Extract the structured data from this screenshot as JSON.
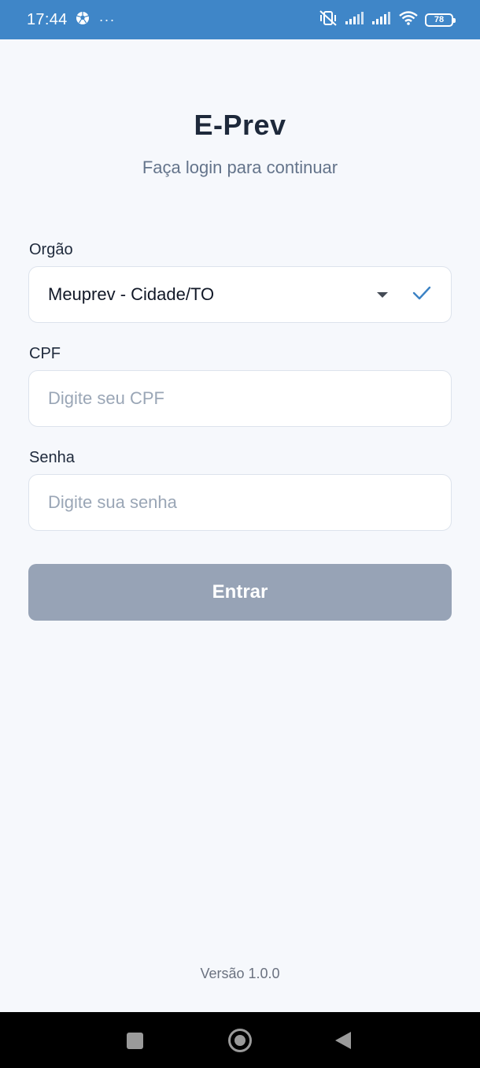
{
  "status_bar": {
    "time": "17:44",
    "more": "···",
    "battery": "78",
    "icons": [
      "soccer-ball-icon",
      "vibrate-off-icon",
      "signal-icon",
      "signal-icon",
      "wifi-icon",
      "battery-icon"
    ]
  },
  "header": {
    "title": "E-Prev",
    "subtitle": "Faça login para continuar"
  },
  "form": {
    "orgao_label": "Orgão",
    "orgao_value": "Meuprev - Cidade/TO",
    "cpf_label": "CPF",
    "cpf_placeholder": "Digite seu CPF",
    "cpf_value": "",
    "senha_label": "Senha",
    "senha_placeholder": "Digite sua senha",
    "senha_value": "",
    "submit_label": "Entrar"
  },
  "footer": {
    "version": "Versão 1.0.0"
  },
  "colors": {
    "status_bar": "#3f86c8",
    "background": "#f6f8fc",
    "button_disabled": "#97a3b6",
    "check": "#3b82c4"
  }
}
